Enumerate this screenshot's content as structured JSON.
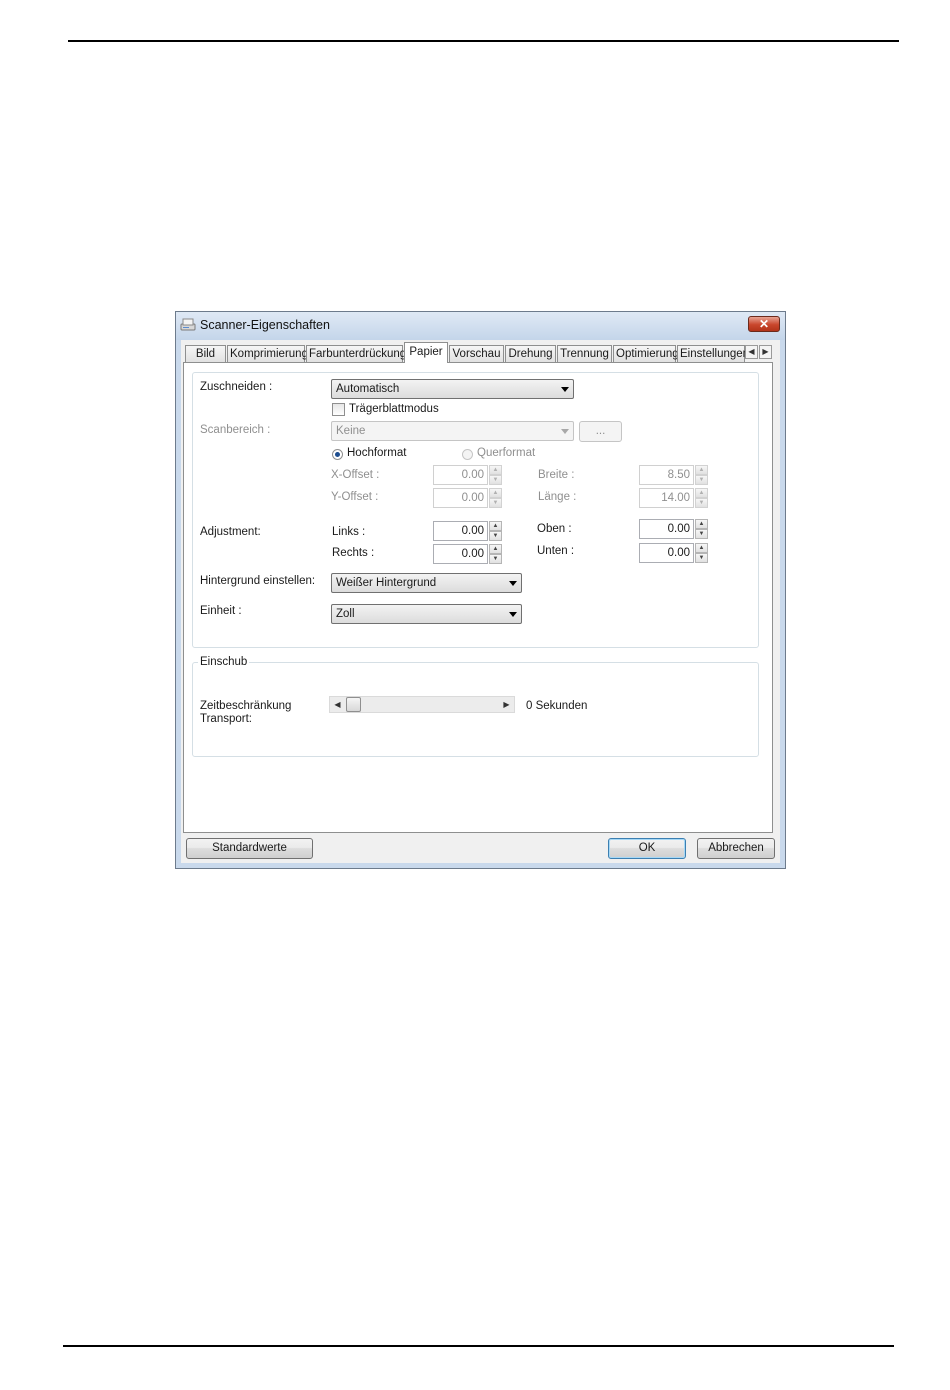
{
  "window": {
    "title": "Scanner-Eigenschaften",
    "close_label": "✕"
  },
  "tabs": [
    {
      "label": "Bild"
    },
    {
      "label": "Komprimierung"
    },
    {
      "label": "Farbunterdrückung"
    },
    {
      "label": "Papier",
      "active": true
    },
    {
      "label": "Vorschau"
    },
    {
      "label": "Drehung"
    },
    {
      "label": "Trennung"
    },
    {
      "label": "Optimierung"
    },
    {
      "label": "Einstellungen"
    }
  ],
  "paper": {
    "crop_label": "Zuschneiden :",
    "crop_value": "Automatisch",
    "carrier_label": "Trägerblattmodus",
    "carrier_checked": false,
    "scan_area_label": "Scanbereich :",
    "scan_area_value": "Keine",
    "browse_label": "...",
    "portrait_label": "Hochformat",
    "landscape_label": "Querformat",
    "x_offset_label": "X-Offset :",
    "x_offset_value": "0.00",
    "y_offset_label": "Y-Offset :",
    "y_offset_value": "0.00",
    "width_label": "Breite :",
    "width_value": "8.50",
    "length_label": "Länge :",
    "length_value": "14.00",
    "adjustment_label": "Adjustment:",
    "left_label": "Links :",
    "left_value": "0.00",
    "right_label": "Rechts :",
    "right_value": "0.00",
    "top_label": "Oben :",
    "top_value": "0.00",
    "bottom_label": "Unten :",
    "bottom_value": "0.00",
    "background_label": "Hintergrund einstellen:",
    "background_value": "Weißer Hintergrund",
    "unit_label": "Einheit :",
    "unit_value": "Zoll"
  },
  "feed": {
    "group_label": "Einschub",
    "timeout_label_line1": "Zeitbeschränkung",
    "timeout_label_line2": "Transport:",
    "timeout_value": "0 Sekunden",
    "timeout_slider_level": 0
  },
  "buttons": {
    "defaults": "Standardwerte",
    "ok": "OK",
    "cancel": "Abbrechen"
  }
}
